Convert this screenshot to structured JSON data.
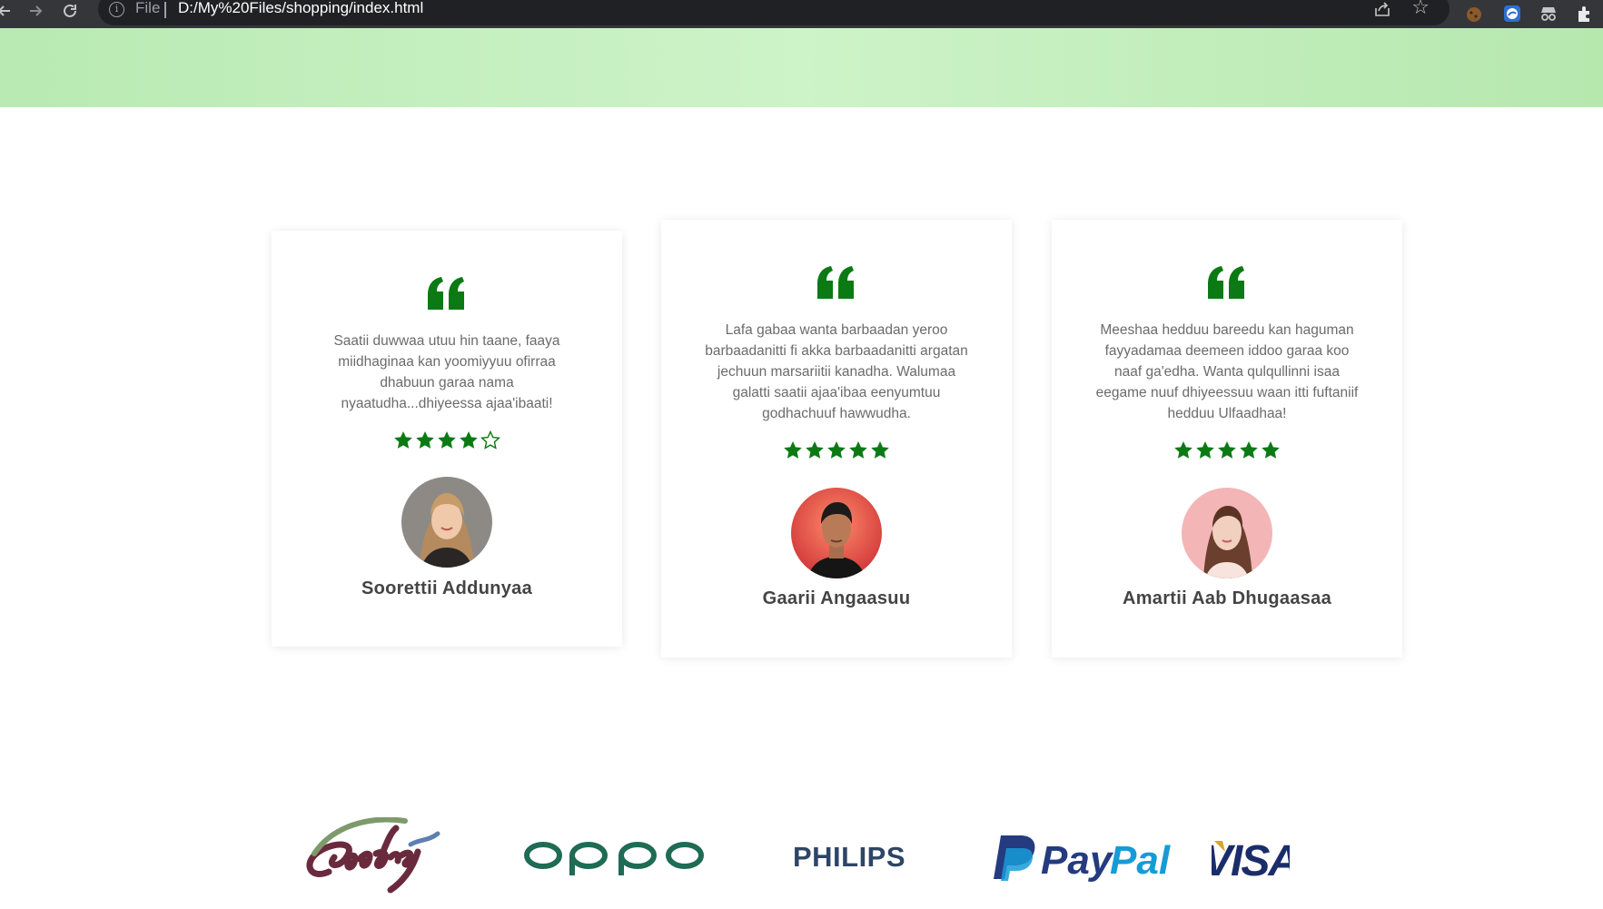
{
  "browser": {
    "scheme_label": "File",
    "url": "D:/My%20Files/shopping/index.html",
    "icons": [
      "back-arrow-icon",
      "forward-arrow-icon",
      "reload-icon",
      "info-icon",
      "share-icon",
      "bookmark-star-icon",
      "extension-icon"
    ]
  },
  "colors": {
    "accent_green": "#0b7a14",
    "banner_green": "#c6f0c0",
    "text_gray": "#6b6b6b",
    "name_gray": "#444444"
  },
  "testimonials": [
    {
      "text_lines": [
        "Saatii duwwaa utuu hin taane, faaya",
        "miidhaginaa kan yoomiyyuu ofirraa",
        "dhabuun garaa nama",
        "nyaatudha...dhiyeessa ajaa'ibaati!"
      ],
      "rating": 4,
      "rating_max": 5,
      "name": "Soorettii Addunyaa",
      "avatar": "woman-blonde-portrait"
    },
    {
      "text_lines": [
        "Lafa gabaa wanta barbaadan yeroo",
        "barbaadanitti fi akka barbaadanitti argatan",
        "jechuun marsariitii kanadha. Walumaa",
        "galatti saatii ajaa'ibaa eenyumtuu",
        "godhachuuf hawwudha."
      ],
      "rating": 5,
      "rating_max": 5,
      "name": "Gaarii Angaasuu",
      "avatar": "man-dark-hair-portrait"
    },
    {
      "text_lines": [
        "Meeshaa hedduu bareedu kan haguman",
        "fayyadamaa deemeen iddoo garaa koo",
        "naaf ga'edha. Wanta qulqullinni isaa",
        "eegame nuuf dhiyeessuu waan itti fuftaniif",
        "hedduu Ulfaadhaa!"
      ],
      "rating": 5,
      "rating_max": 5,
      "name": "Amartii Aab Dhugaasaa",
      "avatar": "woman-pink-background-portrait"
    }
  ],
  "brands": [
    {
      "name": "godrej",
      "text": "Godrej"
    },
    {
      "name": "oppo",
      "text": "oppo"
    },
    {
      "name": "philips",
      "text": "PHILIPS"
    },
    {
      "name": "paypal",
      "text": "PayPal"
    },
    {
      "name": "visa",
      "text": "VISA"
    }
  ]
}
